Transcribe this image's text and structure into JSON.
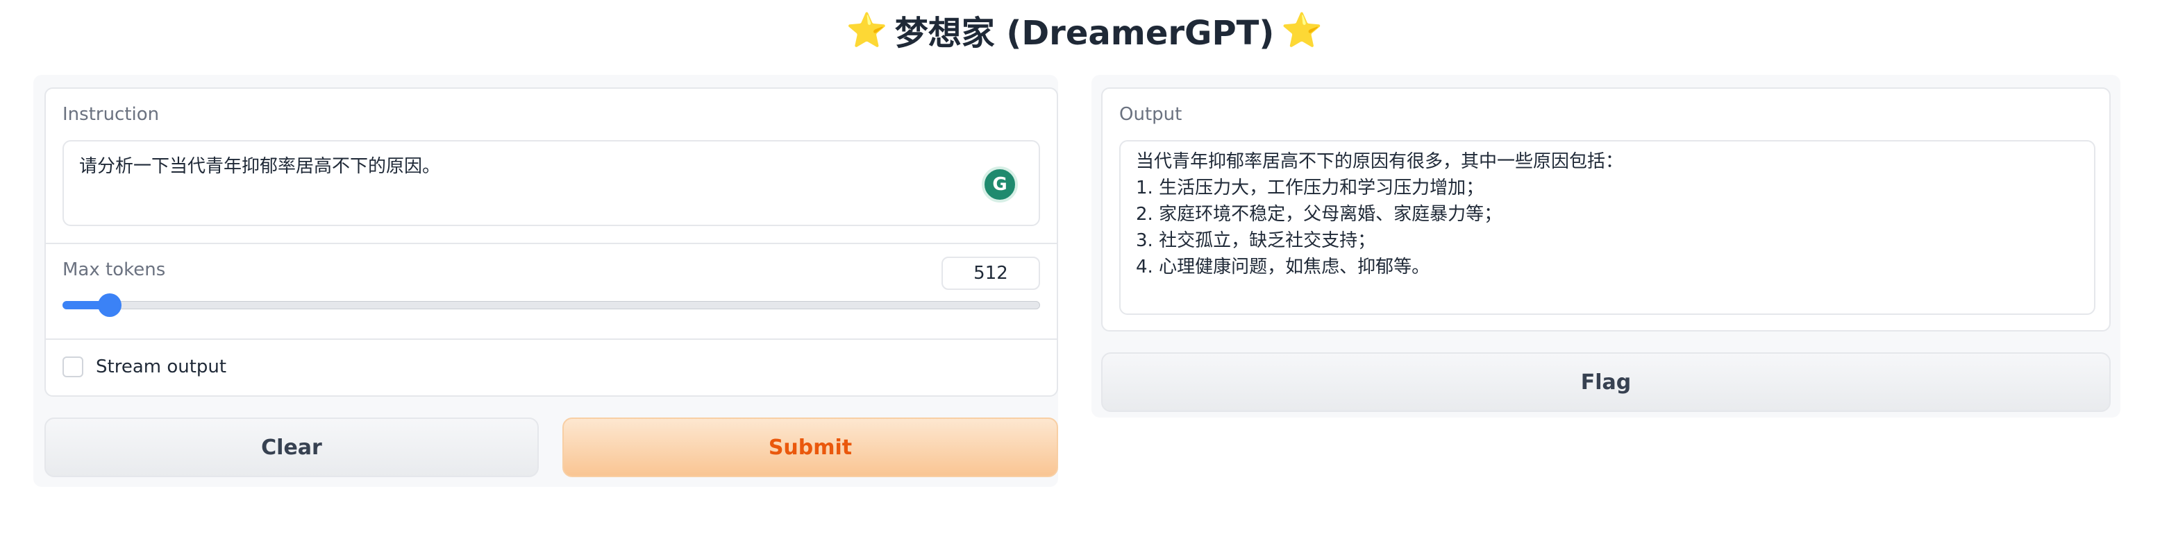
{
  "header": {
    "title": "梦想家 (DreamerGPT)",
    "star_left": "⭐",
    "star_right": "⭐"
  },
  "input_panel": {
    "instruction_label": "Instruction",
    "instruction_value": "请分析一下当代青年抑郁率居高不下的原因。",
    "grammarly_glyph": "G",
    "max_tokens_label": "Max tokens",
    "max_tokens_value": "512",
    "max_tokens_level": 0.036,
    "stream_label": "Stream output",
    "stream_checked": false
  },
  "actions": {
    "clear_label": "Clear",
    "submit_label": "Submit"
  },
  "output_panel": {
    "output_label": "Output",
    "lines": [
      "当代青年抑郁率居高不下的原因有很多，其中一些原因包括：",
      "1. 生活压力大，工作压力和学习压力增加；",
      "2. 家庭环境不稳定，父母离婚、家庭暴力等；",
      "3. 社交孤立，缺乏社交支持；",
      "4. 心理健康问题，如焦虑、抑郁等。"
    ],
    "flag_label": "Flag"
  },
  "colors": {
    "accent": "#3b82f6",
    "primary_button_text": "#ea580c",
    "grammarly": "#1f8a6e"
  }
}
